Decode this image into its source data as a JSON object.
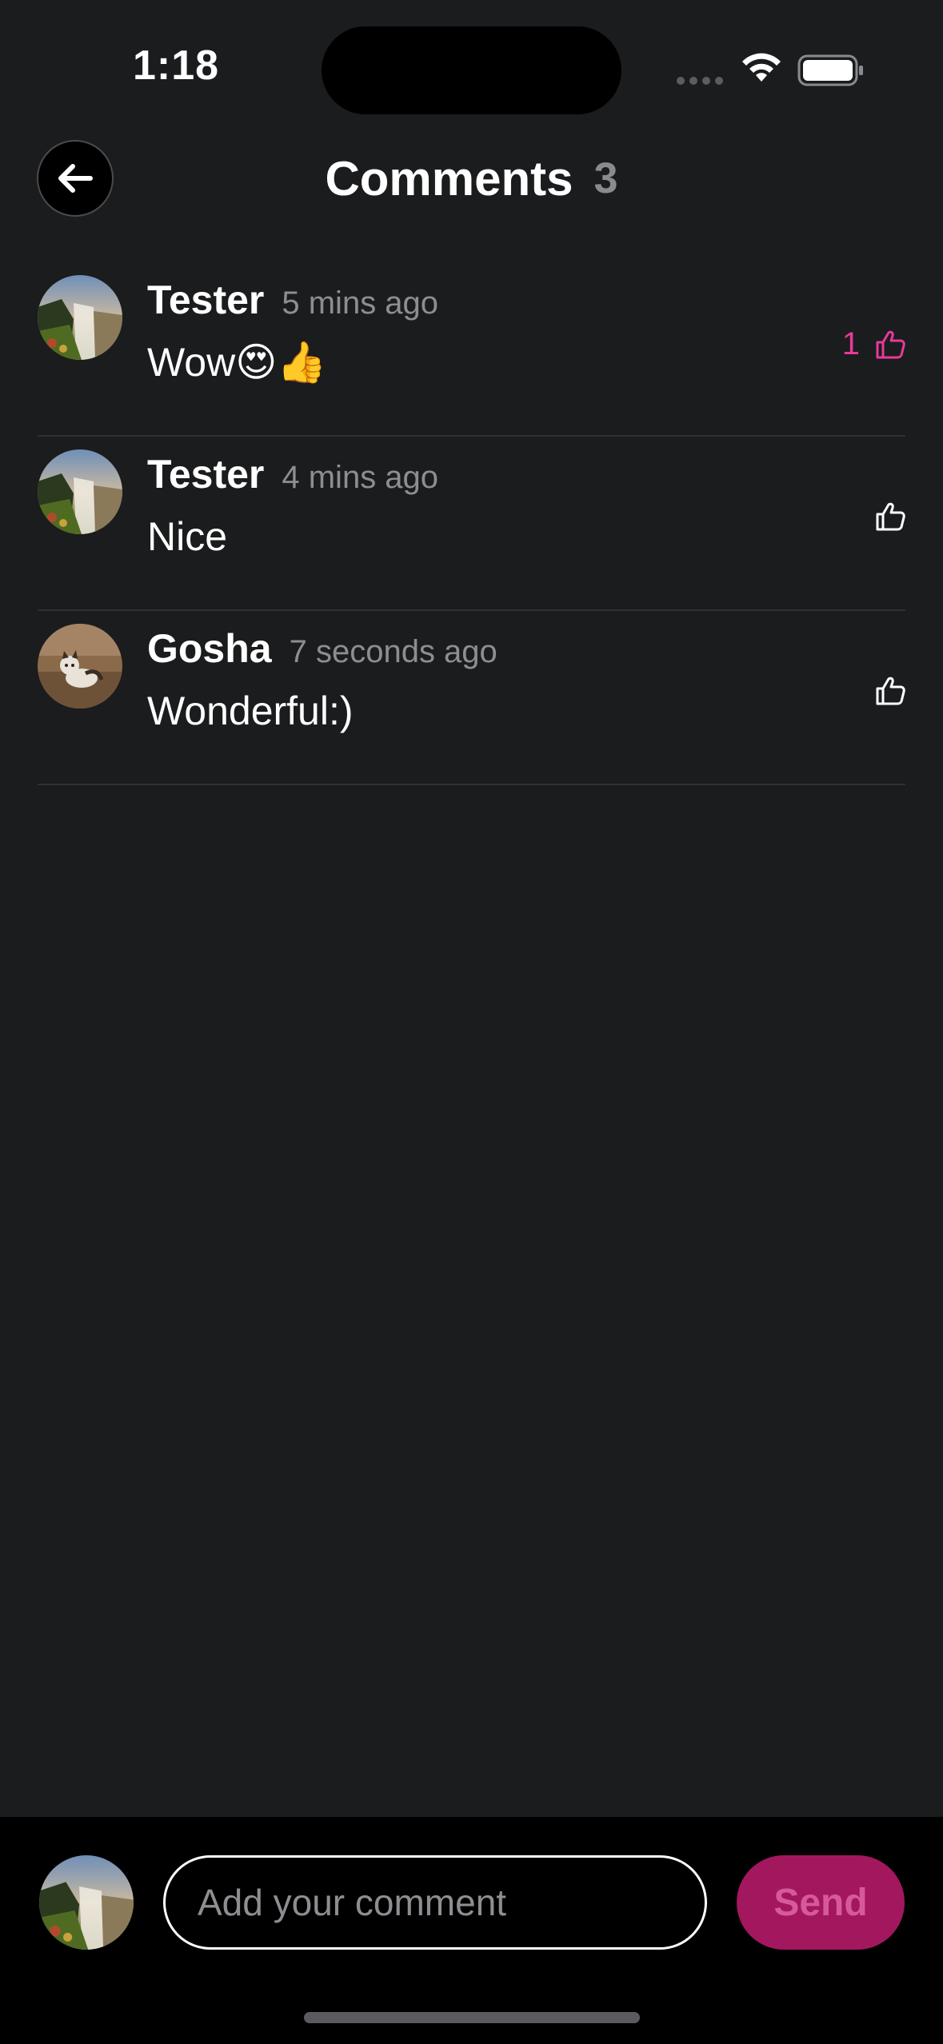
{
  "status_bar": {
    "time": "1:18"
  },
  "header": {
    "title": "Comments",
    "count": "3"
  },
  "comments": [
    {
      "author": "Tester",
      "time": "5 mins ago",
      "text": "Wow😍👍",
      "likes": "1",
      "liked": true,
      "avatar": "waterfall-avatar"
    },
    {
      "author": "Tester",
      "time": "4 mins ago",
      "text": "Nice",
      "likes": "",
      "liked": false,
      "avatar": "waterfall-avatar"
    },
    {
      "author": "Gosha",
      "time": "7 seconds ago",
      "text": "Wonderful:)",
      "likes": "",
      "liked": false,
      "avatar": "cat-avatar"
    }
  ],
  "composer": {
    "placeholder": "Add your comment",
    "send_label": "Send"
  },
  "colors": {
    "background": "#1b1c1e",
    "accent": "#e8399a",
    "send_button": "#a3175f"
  }
}
